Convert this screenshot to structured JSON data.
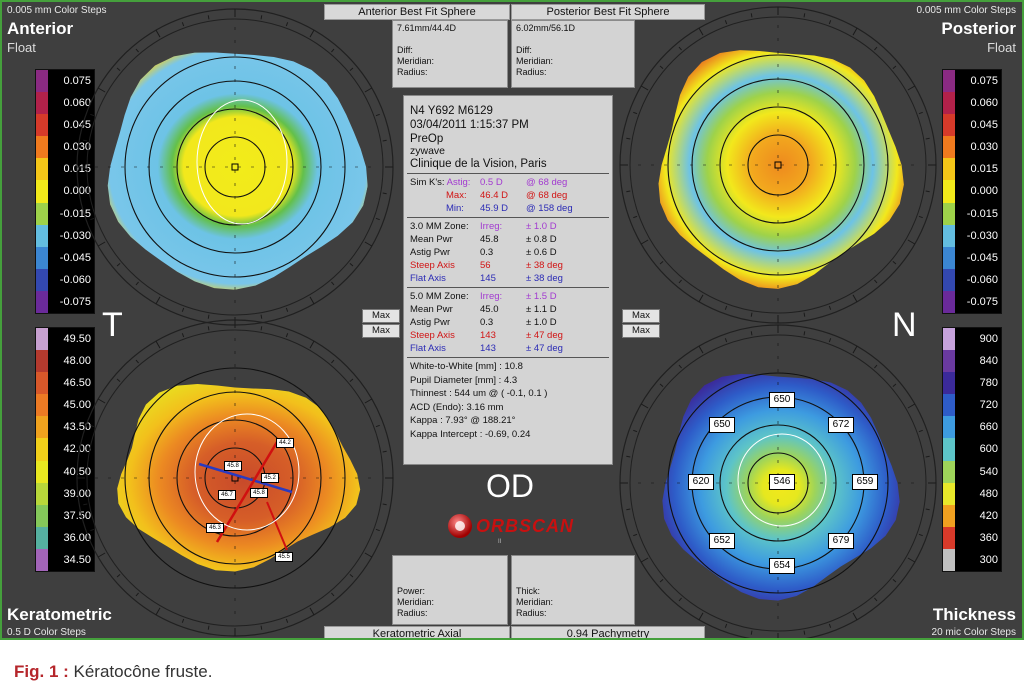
{
  "top_steps_left": "0.005 mm Color Steps",
  "top_steps_right": "0.005 mm Color Steps",
  "anterior": {
    "title": "Anterior",
    "subtitle": "Float"
  },
  "posterior": {
    "title": "Posterior",
    "subtitle": "Float"
  },
  "keratometric": {
    "title": "Keratometric",
    "subtitle": "0.5 D Color Steps"
  },
  "thickness": {
    "title": "Thickness",
    "subtitle": "20 mic Color Steps"
  },
  "header_tabs": {
    "anterior": "Anterior Best Fit Sphere",
    "posterior": "Posterior Best Fit Sphere"
  },
  "footer_tabs": {
    "keratometric": "Keratometric Axial",
    "pachymetry": "0.94 Pachymetry"
  },
  "bfs_anterior": {
    "value": "7.61mm/44.4D",
    "diff": "Diff:",
    "meridian": "Meridian:",
    "radius": "Radius:"
  },
  "bfs_posterior": {
    "value": "6.02mm/56.1D",
    "diff": "Diff:",
    "meridian": "Meridian:",
    "radius": "Radius:"
  },
  "bottom_left_cell": {
    "power": "Power:",
    "meridian": "Meridian:",
    "radius": "Radius:"
  },
  "bottom_right_cell": {
    "thick": "Thick:",
    "meridian": "Meridian:",
    "radius": "Radius:"
  },
  "side_letters": {
    "left": "T",
    "right": "N"
  },
  "eye": "OD",
  "logo": "ORBSCAN",
  "logo_sub": "II",
  "max_buttons": {
    "label": "Max"
  },
  "float_scale": {
    "values": [
      "0.075",
      "0.060",
      "0.045",
      "0.030",
      "0.015",
      "0.000",
      "-0.015",
      "-0.030",
      "-0.045",
      "-0.060",
      "-0.075"
    ],
    "colors": [
      "#8a2a82",
      "#b2214a",
      "#d63a2a",
      "#f07a1e",
      "#f5c618",
      "#f2ea1a",
      "#9ed24a",
      "#63bde0",
      "#3b86d2",
      "#3348b0",
      "#6a2a9a"
    ]
  },
  "kerato_scale": {
    "values": [
      "49.50",
      "48.00",
      "46.50",
      "45.00",
      "43.50",
      "42.00",
      "40.50",
      "39.00",
      "37.50",
      "36.00",
      "34.50"
    ],
    "colors": [
      "#c7a0d0",
      "#b43a2e",
      "#d8582a",
      "#ec7a24",
      "#f0a21e",
      "#f2d01a",
      "#e8e820",
      "#b8d83a",
      "#84c85a",
      "#55b0a0",
      "#a264b8"
    ]
  },
  "thick_scale": {
    "values": [
      "900",
      "840",
      "780",
      "720",
      "660",
      "600",
      "540",
      "480",
      "420",
      "360",
      "300"
    ],
    "colors": [
      "#c6a2dc",
      "#6a3aa0",
      "#3b2a9a",
      "#2e5cc8",
      "#3d9be0",
      "#5dc4c8",
      "#9ed45a",
      "#e8e82a",
      "#f0a020",
      "#d83a2a",
      "#c0c0c0"
    ]
  },
  "info_panel": {
    "line1": "N4 Y692 M6129",
    "line2": "03/04/2011 1:15:37 PM",
    "line3": "PreOp",
    "line4": "zywave",
    "line5": "Clinique de la Vision, Paris",
    "simk": {
      "astig": {
        "label": "Sim K's:",
        "name": "Astig:",
        "value": "0.5 D",
        "deg": "@ 68 deg"
      },
      "max": {
        "name": "Max:",
        "value": "46.4 D",
        "deg": "@ 68 deg"
      },
      "min": {
        "name": "Min:",
        "value": "45.9 D",
        "deg": "@ 158 deg"
      }
    },
    "zone3": {
      "title": "3.0 MM Zone:",
      "irreg_label": "Irreg:",
      "irreg": "± 1.0 D",
      "mean_label": "Mean Pwr",
      "mean": "45.8",
      "mean_pm": "± 0.8 D",
      "astig_label": "Astig Pwr",
      "astig": "0.3",
      "astig_pm": "± 0.6 D",
      "steep_label": "Steep Axis",
      "steep": "56",
      "steep_pm": "± 38 deg",
      "flat_label": "Flat Axis",
      "flat": "145",
      "flat_pm": "± 38 deg"
    },
    "zone5": {
      "title": "5.0 MM Zone:",
      "irreg_label": "Irreg:",
      "irreg": "± 1.5 D",
      "mean_label": "Mean Pwr",
      "mean": "45.0",
      "mean_pm": "± 1.1 D",
      "astig_label": "Astig Pwr",
      "astig": "0.3",
      "astig_pm": "± 1.0 D",
      "steep_label": "Steep Axis",
      "steep": "143",
      "steep_pm": "± 47 deg",
      "flat_label": "Flat Axis",
      "flat": "143",
      "flat_pm": "± 47 deg"
    },
    "w2w": "White-to-White [mm] : 10.8",
    "pupil": "Pupil Diameter [mm] :  4.3",
    "thinnest": "Thinnest : 544 um @ ( -0.1, 0.1 )",
    "acd": "ACD (Endo): 3.16 mm",
    "kappa": "Kappa : 7.93° @ 188.21°",
    "kappa_intercept": "Kappa Intercept : -0.69, 0.24"
  },
  "kerato_labels": [
    "44.2",
    "45.8",
    "45.2",
    "46.7",
    "45.8",
    "46.3",
    "45.5"
  ],
  "pachy_labels": [
    "650",
    "650",
    "672",
    "620",
    "546",
    "659",
    "652",
    "679",
    "654"
  ],
  "caption": {
    "prefix": "Fig. 1 :",
    "text": " Kératocône fruste."
  }
}
